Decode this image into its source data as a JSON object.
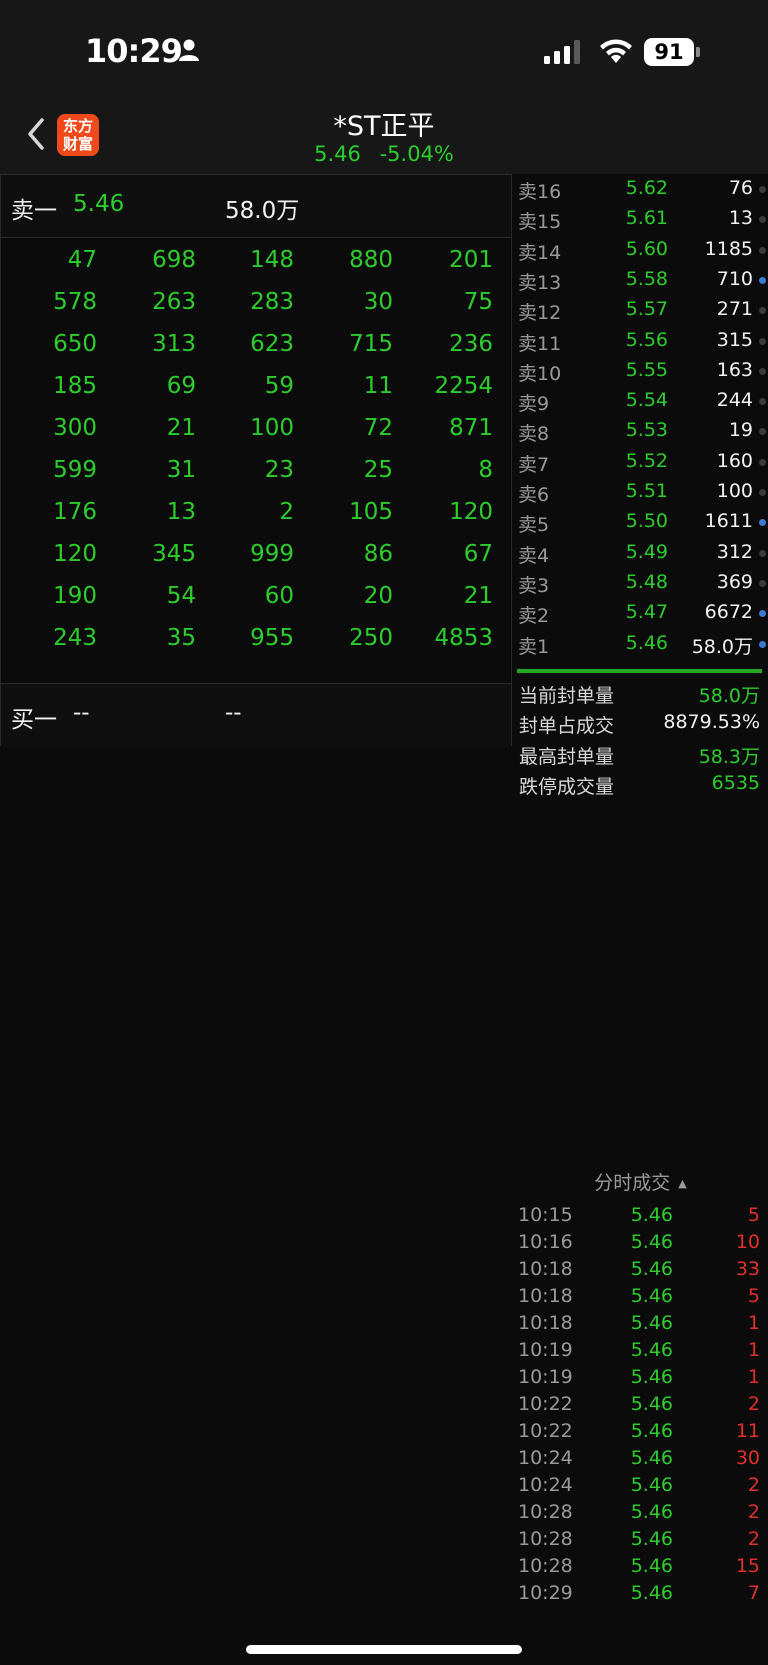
{
  "status_bar": {
    "time": "10:29",
    "battery": "91"
  },
  "header": {
    "title": "*ST正平",
    "price": "5.46",
    "change": "-5.04%",
    "logo_line1": "东方",
    "logo_line2": "财富"
  },
  "left_panel": {
    "sell_one": {
      "label": "卖一",
      "price": "5.46",
      "volume": "58.0万"
    },
    "buy_one": {
      "label": "买一",
      "price": "--",
      "volume": "--"
    },
    "queue_rows": [
      [
        "47",
        "698",
        "148",
        "880",
        "201"
      ],
      [
        "578",
        "263",
        "283",
        "30",
        "75"
      ],
      [
        "650",
        "313",
        "623",
        "715",
        "236"
      ],
      [
        "185",
        "69",
        "59",
        "11",
        "2254"
      ],
      [
        "300",
        "21",
        "100",
        "72",
        "871"
      ],
      [
        "599",
        "31",
        "23",
        "25",
        "8"
      ],
      [
        "176",
        "13",
        "2",
        "105",
        "120"
      ],
      [
        "120",
        "345",
        "999",
        "86",
        "67"
      ],
      [
        "190",
        "54",
        "60",
        "20",
        "21"
      ],
      [
        "243",
        "35",
        "955",
        "250",
        "4853"
      ]
    ]
  },
  "order_book": [
    {
      "label": "卖16",
      "price": "5.62",
      "volume": "76",
      "dot": "grey"
    },
    {
      "label": "卖15",
      "price": "5.61",
      "volume": "13",
      "dot": "grey"
    },
    {
      "label": "卖14",
      "price": "5.60",
      "volume": "1185",
      "dot": "grey"
    },
    {
      "label": "卖13",
      "price": "5.58",
      "volume": "710",
      "dot": "blue"
    },
    {
      "label": "卖12",
      "price": "5.57",
      "volume": "271",
      "dot": "grey"
    },
    {
      "label": "卖11",
      "price": "5.56",
      "volume": "315",
      "dot": "grey"
    },
    {
      "label": "卖10",
      "price": "5.55",
      "volume": "163",
      "dot": "grey"
    },
    {
      "label": "卖9",
      "price": "5.54",
      "volume": "244",
      "dot": "grey"
    },
    {
      "label": "卖8",
      "price": "5.53",
      "volume": "19",
      "dot": "grey"
    },
    {
      "label": "卖7",
      "price": "5.52",
      "volume": "160",
      "dot": "grey"
    },
    {
      "label": "卖6",
      "price": "5.51",
      "volume": "100",
      "dot": "grey"
    },
    {
      "label": "卖5",
      "price": "5.50",
      "volume": "1611",
      "dot": "blue"
    },
    {
      "label": "卖4",
      "price": "5.49",
      "volume": "312",
      "dot": "grey"
    },
    {
      "label": "卖3",
      "price": "5.48",
      "volume": "369",
      "dot": "grey"
    },
    {
      "label": "卖2",
      "price": "5.47",
      "volume": "6672",
      "dot": "blue"
    },
    {
      "label": "卖1",
      "price": "5.46",
      "volume": "58.0万",
      "dot": "blue"
    }
  ],
  "stats": [
    {
      "label": "当前封单量",
      "value": "58.0万",
      "color": "green"
    },
    {
      "label": "封单占成交",
      "value": "8879.53%",
      "color": "white"
    },
    {
      "label": "最高封单量",
      "value": "58.3万",
      "color": "green"
    },
    {
      "label": "跌停成交量",
      "value": "6535",
      "color": "green"
    }
  ],
  "trades": {
    "title": "分时成交",
    "rows": [
      {
        "time": "10:15",
        "price": "5.46",
        "volume": "5"
      },
      {
        "time": "10:16",
        "price": "5.46",
        "volume": "10"
      },
      {
        "time": "10:18",
        "price": "5.46",
        "volume": "33"
      },
      {
        "time": "10:18",
        "price": "5.46",
        "volume": "5"
      },
      {
        "time": "10:18",
        "price": "5.46",
        "volume": "1"
      },
      {
        "time": "10:19",
        "price": "5.46",
        "volume": "1"
      },
      {
        "time": "10:19",
        "price": "5.46",
        "volume": "1"
      },
      {
        "time": "10:22",
        "price": "5.46",
        "volume": "2"
      },
      {
        "time": "10:22",
        "price": "5.46",
        "volume": "11"
      },
      {
        "time": "10:24",
        "price": "5.46",
        "volume": "30"
      },
      {
        "time": "10:24",
        "price": "5.46",
        "volume": "2"
      },
      {
        "time": "10:28",
        "price": "5.46",
        "volume": "2"
      },
      {
        "time": "10:28",
        "price": "5.46",
        "volume": "2"
      },
      {
        "time": "10:28",
        "price": "5.46",
        "volume": "15"
      },
      {
        "time": "10:29",
        "price": "5.46",
        "volume": "7"
      }
    ]
  },
  "colors": {
    "green": "#2ccd2c",
    "red": "#e0302c",
    "blue_dot": "#3b7bd6",
    "logo": "#f04a1c",
    "background": "#0b0b0b"
  }
}
